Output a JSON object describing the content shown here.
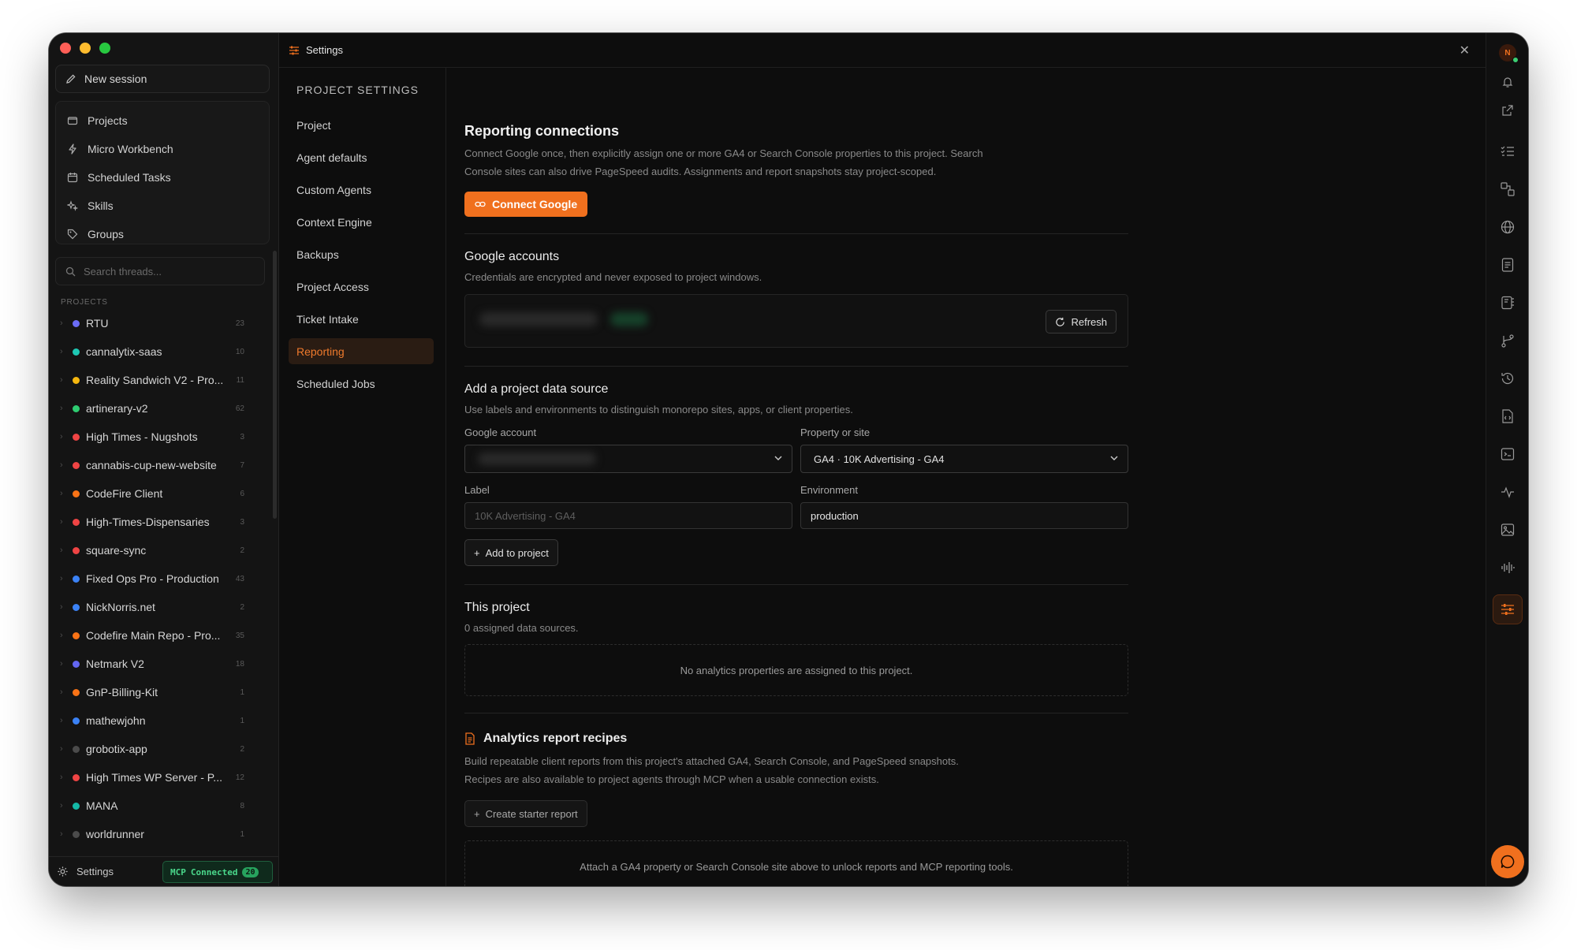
{
  "window": {
    "traffic_colors": [
      "#ff5f57",
      "#febc2e",
      "#28c840"
    ]
  },
  "sidebar": {
    "new_session_label": "New session",
    "nav_items": [
      {
        "label": "Projects",
        "icon": "folder-icon"
      },
      {
        "label": "Micro Workbench",
        "icon": "lightning-icon"
      },
      {
        "label": "Scheduled Tasks",
        "icon": "calendar-icon"
      },
      {
        "label": "Skills",
        "icon": "sparkles-icon"
      },
      {
        "label": "Groups",
        "icon": "tag-icon"
      }
    ],
    "search_placeholder": "Search threads...",
    "projects_label": "PROJECTS",
    "projects": [
      {
        "name": "RTU",
        "count": "23",
        "color": "#6b6cf6"
      },
      {
        "name": "cannalytix-saas",
        "count": "10",
        "color": "#1ec8b4"
      },
      {
        "name": "Reality Sandwich V2 - Pro...",
        "count": "11",
        "color": "#f5b70f"
      },
      {
        "name": "artinerary-v2",
        "count": "62",
        "color": "#2ecc71"
      },
      {
        "name": "High Times - Nugshots",
        "count": "3",
        "color": "#ef4444"
      },
      {
        "name": "cannabis-cup-new-website",
        "count": "7",
        "color": "#ef4444"
      },
      {
        "name": "CodeFire Client",
        "count": "6",
        "color": "#f97316"
      },
      {
        "name": "High-Times-Dispensaries",
        "count": "3",
        "color": "#ef4444"
      },
      {
        "name": "square-sync",
        "count": "2",
        "color": "#ef4444"
      },
      {
        "name": "Fixed Ops Pro - Production",
        "count": "43",
        "color": "#3b82f6"
      },
      {
        "name": "NickNorris.net",
        "count": "2",
        "color": "#3b82f6"
      },
      {
        "name": "Codefire Main Repo - Pro...",
        "count": "35",
        "color": "#f97316"
      },
      {
        "name": "Netmark V2",
        "count": "18",
        "color": "#6366f1"
      },
      {
        "name": "GnP-Billing-Kit",
        "count": "1",
        "color": "#f97316"
      },
      {
        "name": "mathewjohn",
        "count": "1",
        "color": "#3b82f6"
      },
      {
        "name": "grobotix-app",
        "count": "2",
        "color": "#4b4b4b"
      },
      {
        "name": "High Times WP Server - P...",
        "count": "12",
        "color": "#ef4444"
      },
      {
        "name": "MANA",
        "count": "8",
        "color": "#14b8a6"
      },
      {
        "name": "worldrunner",
        "count": "1",
        "color": "#4b4b4b"
      }
    ],
    "footer_settings": "Settings",
    "mcp_label": "MCP",
    "mcp_status": "Connected",
    "mcp_count": "20"
  },
  "titlebar": {
    "title": "Settings"
  },
  "settings_nav": {
    "heading": "PROJECT SETTINGS",
    "items": [
      "Project",
      "Agent defaults",
      "Custom Agents",
      "Context Engine",
      "Backups",
      "Project Access",
      "Ticket Intake",
      "Reporting",
      "Scheduled Jobs"
    ],
    "active": "Reporting"
  },
  "reporting": {
    "title": "Reporting connections",
    "description_line1": "Connect Google once, then explicitly assign one or more GA4 or Search Console properties to this project. Search",
    "description_line2": "Console sites can also drive PageSpeed audits. Assignments and report snapshots stay project-scoped.",
    "connect_button": "Connect Google"
  },
  "accounts": {
    "title": "Google accounts",
    "description": "Credentials are encrypted and never exposed to project windows.",
    "refresh_button": "Refresh"
  },
  "data_source": {
    "title": "Add a project data source",
    "description": "Use labels and environments to distinguish monorepo sites, apps, or client properties.",
    "google_account_label": "Google account",
    "property_label": "Property or site",
    "property_value": "GA4 · 10K Advertising - GA4",
    "label_label": "Label",
    "label_placeholder": "10K Advertising - GA4",
    "environment_label": "Environment",
    "environment_value": "production",
    "add_button": "Add to project"
  },
  "this_project": {
    "title": "This project",
    "subtitle": "0 assigned data sources.",
    "empty_text": "No analytics properties are assigned to this project."
  },
  "recipes": {
    "title": "Analytics report recipes",
    "description_line1": "Build repeatable client reports from this project's attached GA4, Search Console, and PageSpeed snapshots.",
    "description_line2": "Recipes are also available to project agents through MCP when a usable connection exists.",
    "starter_button": "Create starter report",
    "empty_text": "Attach a GA4 property or Search Console site above to unlock reports and MCP reporting tools."
  },
  "rail": {
    "avatar_initial": "N",
    "icons": [
      "bell-icon",
      "external-link-icon",
      "checklist-icon",
      "shapes-icon",
      "globe-icon",
      "document-icon",
      "notebook-icon",
      "git-branch-icon",
      "history-icon",
      "code-file-icon",
      "terminal-icon",
      "activity-icon",
      "image-icon",
      "audio-wave-icon",
      "sliders-icon"
    ],
    "accent": "#f0701e"
  }
}
